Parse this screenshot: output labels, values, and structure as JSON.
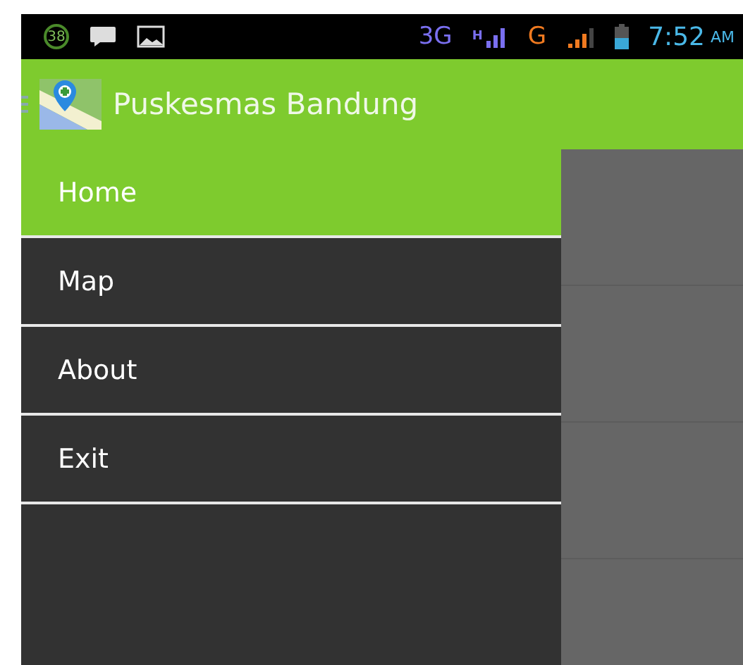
{
  "status_bar": {
    "notification_count": "38",
    "network_3g": "3G",
    "network_h": "H",
    "network_g": "G",
    "time": "7:52",
    "am_pm": "AM"
  },
  "app_bar": {
    "title": "Puskesmas Bandung"
  },
  "drawer": {
    "items": [
      {
        "label": "Home",
        "selected": true
      },
      {
        "label": "Map",
        "selected": false
      },
      {
        "label": "About",
        "selected": false
      },
      {
        "label": "Exit",
        "selected": false
      }
    ]
  }
}
